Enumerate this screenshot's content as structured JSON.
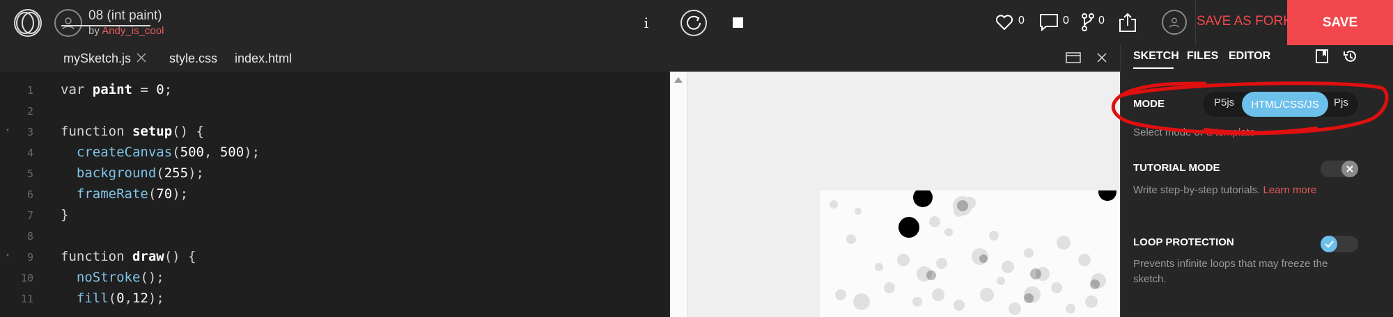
{
  "header": {
    "sketch_title": "08 (int paint)",
    "by_prefix": "by ",
    "author": "Andy_is_cool",
    "info_label": "i",
    "likes": "0",
    "comments": "0",
    "forks": "0",
    "save_as_fork": "SAVE AS FORK",
    "save": "SAVE"
  },
  "editor": {
    "tabs": [
      "mySketch.js",
      "style.css",
      "index.html"
    ],
    "lines": [
      {
        "n": "1",
        "fold": false
      },
      {
        "n": "2",
        "fold": false
      },
      {
        "n": "3",
        "fold": true
      },
      {
        "n": "4",
        "fold": false
      },
      {
        "n": "5",
        "fold": false
      },
      {
        "n": "6",
        "fold": false
      },
      {
        "n": "7",
        "fold": false
      },
      {
        "n": "8",
        "fold": false
      },
      {
        "n": "9",
        "fold": true
      },
      {
        "n": "10",
        "fold": false
      },
      {
        "n": "11",
        "fold": false
      }
    ],
    "code": [
      [
        [
          "kw",
          "var "
        ],
        [
          "fn",
          "paint"
        ],
        [
          "kw",
          " = "
        ],
        [
          "num",
          "0"
        ],
        [
          "kw",
          ";"
        ]
      ],
      [],
      [
        [
          "kw",
          "function "
        ],
        [
          "fn",
          "setup"
        ],
        [
          "kw",
          "() {"
        ]
      ],
      [
        [
          "kw",
          "  "
        ],
        [
          "bi",
          "createCanvas"
        ],
        [
          "kw",
          "("
        ],
        [
          "num",
          "500"
        ],
        [
          "kw",
          ", "
        ],
        [
          "num",
          "500"
        ],
        [
          "kw",
          ");"
        ]
      ],
      [
        [
          "kw",
          "  "
        ],
        [
          "bi",
          "background"
        ],
        [
          "kw",
          "("
        ],
        [
          "num",
          "255"
        ],
        [
          "kw",
          ");"
        ]
      ],
      [
        [
          "kw",
          "  "
        ],
        [
          "bi",
          "frameRate"
        ],
        [
          "kw",
          "("
        ],
        [
          "num",
          "70"
        ],
        [
          "kw",
          ");"
        ]
      ],
      [
        [
          "kw",
          "}"
        ]
      ],
      [],
      [
        [
          "kw",
          "function "
        ],
        [
          "fn",
          "draw"
        ],
        [
          "kw",
          "() {"
        ]
      ],
      [
        [
          "kw",
          "  "
        ],
        [
          "bi",
          "noStroke"
        ],
        [
          "kw",
          "();"
        ]
      ],
      [
        [
          "kw",
          "  "
        ],
        [
          "bi",
          "fill"
        ],
        [
          "kw",
          "("
        ],
        [
          "num",
          "0"
        ],
        [
          "kw",
          ","
        ],
        [
          "num",
          "12"
        ],
        [
          "kw",
          ");"
        ]
      ]
    ]
  },
  "settings": {
    "tabs": [
      "SKETCH",
      "FILES",
      "EDITOR"
    ],
    "mode_label": "MODE",
    "mode_options": [
      "P5js",
      "HTML/CSS/JS",
      "Pjs"
    ],
    "mode_selected": "HTML/CSS/JS",
    "select_mode_text": "Select mode or ",
    "template_link": "a template",
    "tutorial_label": "TUTORIAL MODE",
    "tutorial_desc": "Write step-by-step tutorials. ",
    "learn_more": "Learn more",
    "tutorial_enabled": false,
    "loop_label": "LOOP PROTECTION",
    "loop_desc": "Prevents infinite loops that may freeze the sketch.",
    "loop_enabled": true
  },
  "colors": {
    "accent_red": "#f2474c",
    "accent_blue": "#6cc0ea",
    "annotation": "#e01010"
  },
  "icons": [
    "openprocessing-logo-icon",
    "user-avatar-icon",
    "info-icon",
    "restart-icon",
    "stop-icon",
    "heart-icon",
    "comment-icon",
    "fork-icon",
    "share-icon",
    "profile-icon",
    "close-tab-icon",
    "maximize-icon",
    "close-icon",
    "bookmark-icon",
    "history-icon",
    "chevron-down-icon"
  ]
}
